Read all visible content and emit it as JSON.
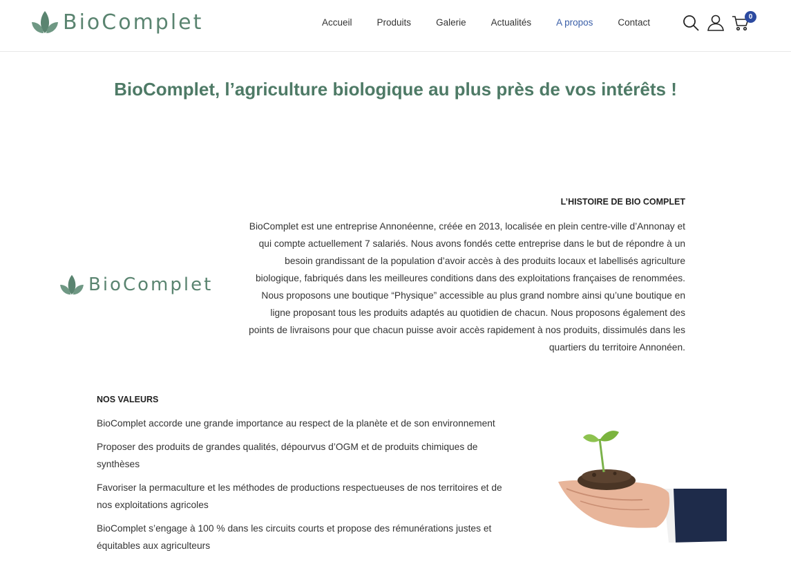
{
  "brand": {
    "name": "BioComplet",
    "color": "#5a8470"
  },
  "nav": {
    "items": [
      {
        "label": "Accueil"
      },
      {
        "label": "Produits"
      },
      {
        "label": "Galerie"
      },
      {
        "label": "Actualités"
      },
      {
        "label": "A propos",
        "active": true
      },
      {
        "label": "Contact"
      }
    ],
    "active_color": "#3b5fa8"
  },
  "header_icons": {
    "search": "search-icon",
    "account": "user-icon",
    "cart": "cart-icon",
    "cart_count": "0"
  },
  "main": {
    "title": "BioComplet, l’agriculture biologique au plus près de vos intérêts !",
    "title_color": "#4e7a66"
  },
  "history": {
    "heading": "L’HISTOIRE DE BIO COMPLET",
    "body": "BioComplet est une entreprise Annonéenne, créée en 2013, localisée en plein centre-ville d’Annonay et qui compte actuellement 7 salariés. Nous avons fondés cette entreprise dans le but de répondre à un besoin grandissant de la population d’avoir accès à des produits locaux et labellisés agriculture biologique, fabriqués dans les meilleures conditions dans des exploitations françaises de renommées. Nous proposons une boutique “Physique” accessible au plus grand nombre ainsi qu’une boutique en ligne proposant tous les produits adaptés au quotidien de chacun. Nous proposons également des points de livraisons pour que chacun puisse avoir accès rapidement à nos produits, dissimulés dans les quartiers du territoire Annonéen."
  },
  "values": {
    "heading": "NOS VALEURS",
    "items": [
      "BioComplet accorde une grande importance au respect de la planète et de son environnement",
      "Proposer des produits de grandes qualités, dépourvus d’OGM et de produits chimiques de synthèses",
      "Favoriser la permaculture et les méthodes de productions respectueuses de nos territoires et de nos exploitations agricoles",
      "BioComplet s’engage à 100 % dans les circuits courts et propose des rémunérations justes et équitables aux agriculteurs"
    ]
  }
}
